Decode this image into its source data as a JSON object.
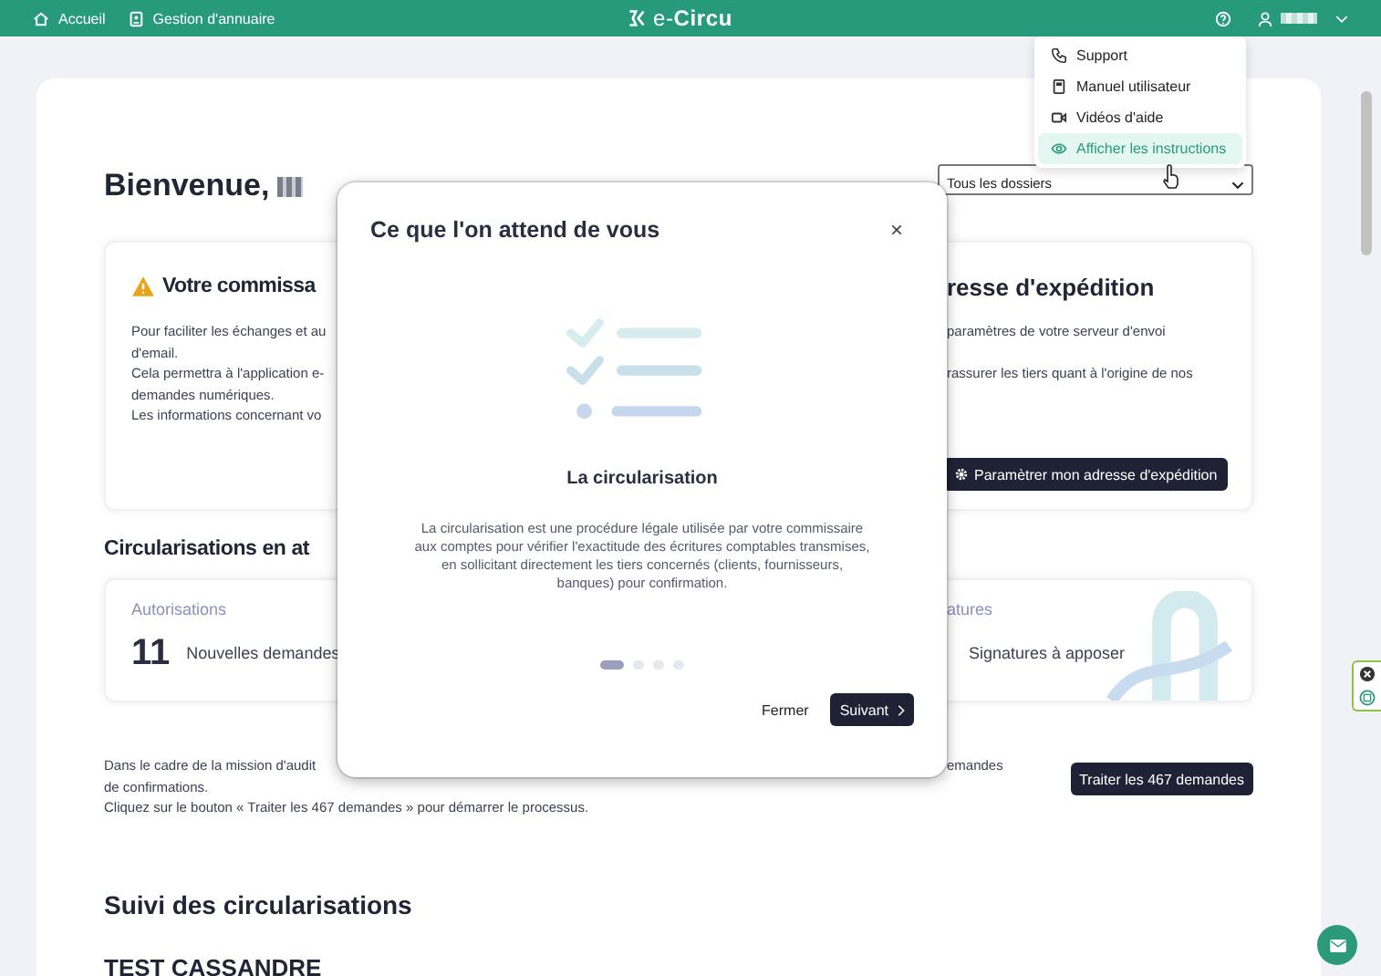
{
  "header": {
    "nav": [
      {
        "label": "Accueil"
      },
      {
        "label": "Gestion d'annuaire"
      }
    ],
    "logo": "e-**Circu**"
  },
  "help_menu": {
    "items": [
      {
        "label": "Support",
        "selected": false
      },
      {
        "label": "Manuel utilisateur",
        "selected": false
      },
      {
        "label": "Vidéos d'aide",
        "selected": false
      },
      {
        "label": "Afficher les instructions",
        "selected": true
      }
    ]
  },
  "welcome": {
    "title": "Bienvenue,"
  },
  "folder_select": {
    "value": "Tous les dossiers"
  },
  "auditor_card": {
    "title": "Votre commissa",
    "lines": [
      "Pour faciliter les échanges et au",
      "d'email.",
      "Cela permettra à l'application e-",
      "demandes numériques.",
      "Les informations concernant vo"
    ]
  },
  "sender_card": {
    "title": "resse d'expédition",
    "lines": [
      "paramètres de votre serveur d'envoi",
      "rassurer les tiers quant à l'origine de nos"
    ],
    "button": "Paramètrer mon adresse d'expédition"
  },
  "pending": {
    "title": "Circularisations en at",
    "left": {
      "label": "Autorisations",
      "count": "11",
      "text": "Nouvelles demandes"
    },
    "right": {
      "label": "atures",
      "text": "Signatures à apposer"
    }
  },
  "process": {
    "lines": [
      "Dans le cadre de la mission d'audit",
      "de confirmations.",
      "Cliquez sur le bouton « Traiter les 467 demandes » pour démarrer le processus."
    ],
    "right_text": "emandes",
    "button": "Traiter les 467 demandes"
  },
  "tracking": {
    "title": "Suivi des circularisations",
    "first_entry": "TEST CASSANDRE"
  },
  "modal": {
    "title": "Ce que l'on attend de vous",
    "close": "×",
    "heading": "La circularisation",
    "body": "La circularisation est une procédure légale utilisée par votre commissaire aux comptes pour vérifier l'exactitude des écritures comptables transmises, en sollicitant directement les tiers concernés (clients, fournisseurs, banques) pour confirmation.",
    "steps": [
      {
        "selected": true
      },
      {
        "selected": false
      },
      {
        "selected": false
      },
      {
        "selected": false
      }
    ],
    "buttons": [
      {
        "kind": "secondary",
        "label": "Fermer"
      },
      {
        "kind": "primary",
        "label": "Suivant"
      }
    ]
  }
}
